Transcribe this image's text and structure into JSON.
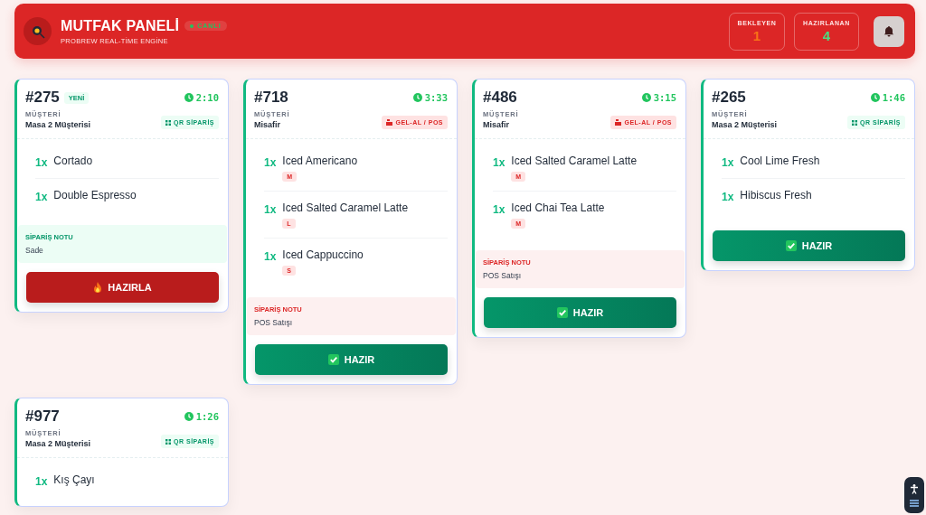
{
  "header": {
    "title": "MUTFAK PANELİ",
    "live_badge": "CANLI",
    "subtitle": "PROBREW REAL-TİME ENGİNE",
    "stats": [
      {
        "label": "BEKLEYEN",
        "value": "1",
        "color": "#f97316"
      },
      {
        "label": "HAZIRLANAN",
        "value": "4",
        "color": "#4ade80"
      }
    ]
  },
  "orders": [
    {
      "number": "#275",
      "badge": "YENİ",
      "timer": "2:10",
      "customer_label": "MÜŞTERİ",
      "customer": "Masa 2 Müşterisi",
      "kind": "qr",
      "tag": "QR SİPARİŞ",
      "items": [
        {
          "qty": "1x",
          "name": "Cortado"
        },
        {
          "qty": "1x",
          "name": "Double Espresso"
        }
      ],
      "note": {
        "label": "SİPARİŞ NOTU",
        "text": "Sade"
      },
      "action": {
        "kind": "prepare",
        "label": "HAZIRLA"
      }
    },
    {
      "number": "#718",
      "timer": "3:33",
      "customer_label": "MÜŞTERİ",
      "customer": "Misafir",
      "kind": "pos",
      "tag": "GEL-AL / POS",
      "items": [
        {
          "qty": "1x",
          "name": "Iced Americano",
          "size": "M"
        },
        {
          "qty": "1x",
          "name": "Iced Salted Caramel Latte",
          "size": "L"
        },
        {
          "qty": "1x",
          "name": "Iced Cappuccino",
          "size": "S"
        }
      ],
      "note": {
        "label": "SİPARİŞ NOTU",
        "text": "POS Satışı"
      },
      "action": {
        "kind": "ready",
        "label": "HAZIR"
      }
    },
    {
      "number": "#486",
      "timer": "3:15",
      "customer_label": "MÜŞTERİ",
      "customer": "Misafir",
      "kind": "pos",
      "tag": "GEL-AL / POS",
      "items": [
        {
          "qty": "1x",
          "name": "Iced Salted Caramel Latte",
          "size": "M"
        },
        {
          "qty": "1x",
          "name": "Iced Chai Tea Latte",
          "size": "M"
        }
      ],
      "note": {
        "label": "SİPARİŞ NOTU",
        "text": "POS Satışı"
      },
      "action": {
        "kind": "ready",
        "label": "HAZIR"
      }
    },
    {
      "number": "#265",
      "timer": "1:46",
      "customer_label": "MÜŞTERİ",
      "customer": "Masa 2 Müşterisi",
      "kind": "qr",
      "tag": "QR SİPARİŞ",
      "items": [
        {
          "qty": "1x",
          "name": "Cool Lime Fresh"
        },
        {
          "qty": "1x",
          "name": "Hibiscus Fresh"
        }
      ],
      "action": {
        "kind": "ready",
        "label": "HAZIR"
      }
    },
    {
      "number": "#977",
      "timer": "1:26",
      "customer_label": "MÜŞTERİ",
      "customer": "Masa 2 Müşterisi",
      "kind": "qr",
      "tag": "QR SİPARİŞ",
      "items": [
        {
          "qty": "1x",
          "name": "Kış Çayı"
        }
      ]
    }
  ]
}
